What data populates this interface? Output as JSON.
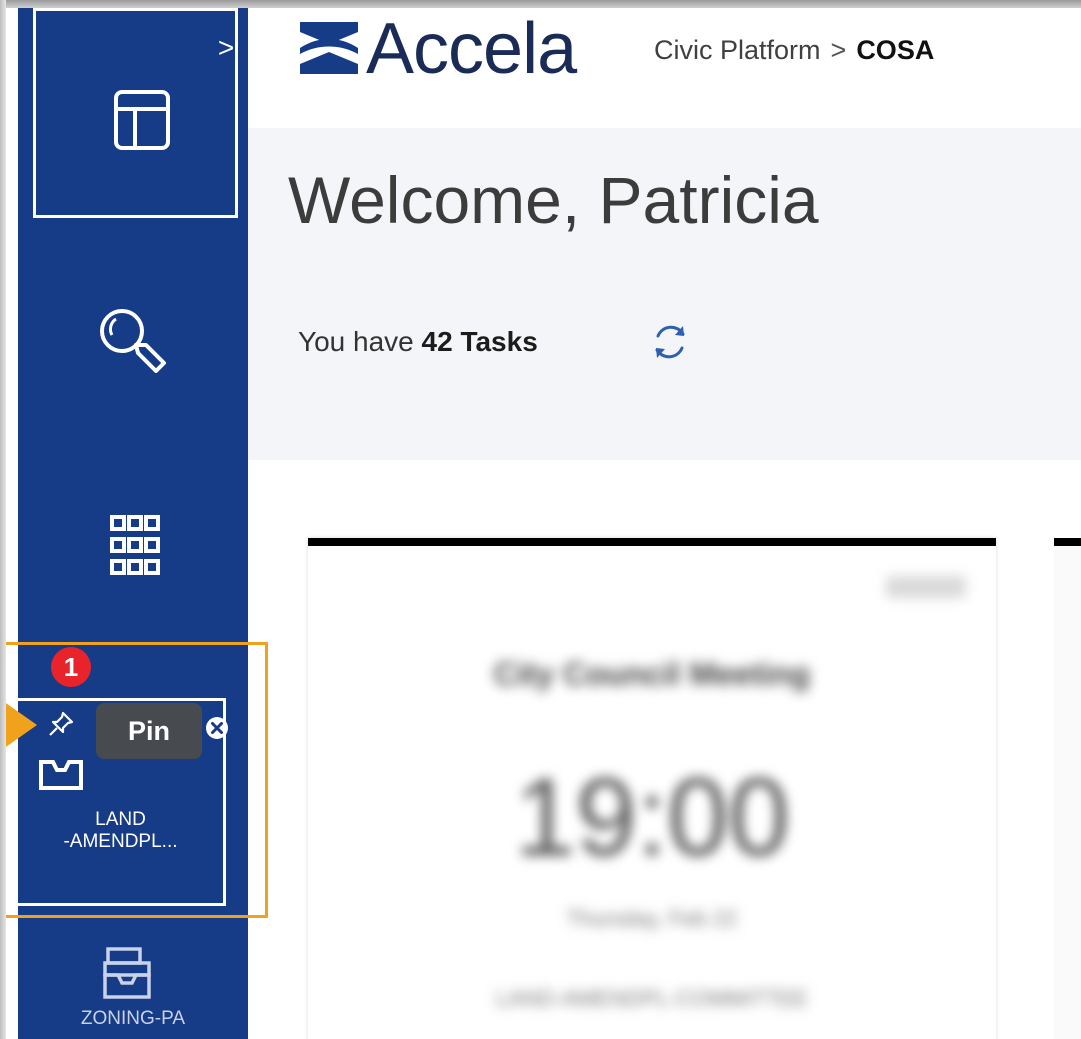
{
  "header": {
    "logo_text": "Accela",
    "breadcrumb": {
      "platform": "Civic Platform",
      "separator": ">",
      "agency": "COSA"
    }
  },
  "welcome": {
    "title": "Welcome, Patricia",
    "tasks_prefix": "You have",
    "tasks_count": "42 Tasks"
  },
  "sidebar": {
    "expand_glyph": ">",
    "pinned_tile": {
      "label_line1": "LAND",
      "label_line2": "-AMENDPL...",
      "tooltip": "Pin",
      "badge": "1"
    },
    "next_tile": {
      "label": "ZONING-PA"
    }
  },
  "card": {
    "title": "City Council Meeting",
    "time": "19:00",
    "date": "Thursday, Feb 22",
    "code": "LAND-AMENDPL-COMMITTEE"
  },
  "colors": {
    "sidebar": "#163b87",
    "highlight": "#f0a21c",
    "badge": "#e8242a",
    "tooltip": "#474a4f"
  }
}
